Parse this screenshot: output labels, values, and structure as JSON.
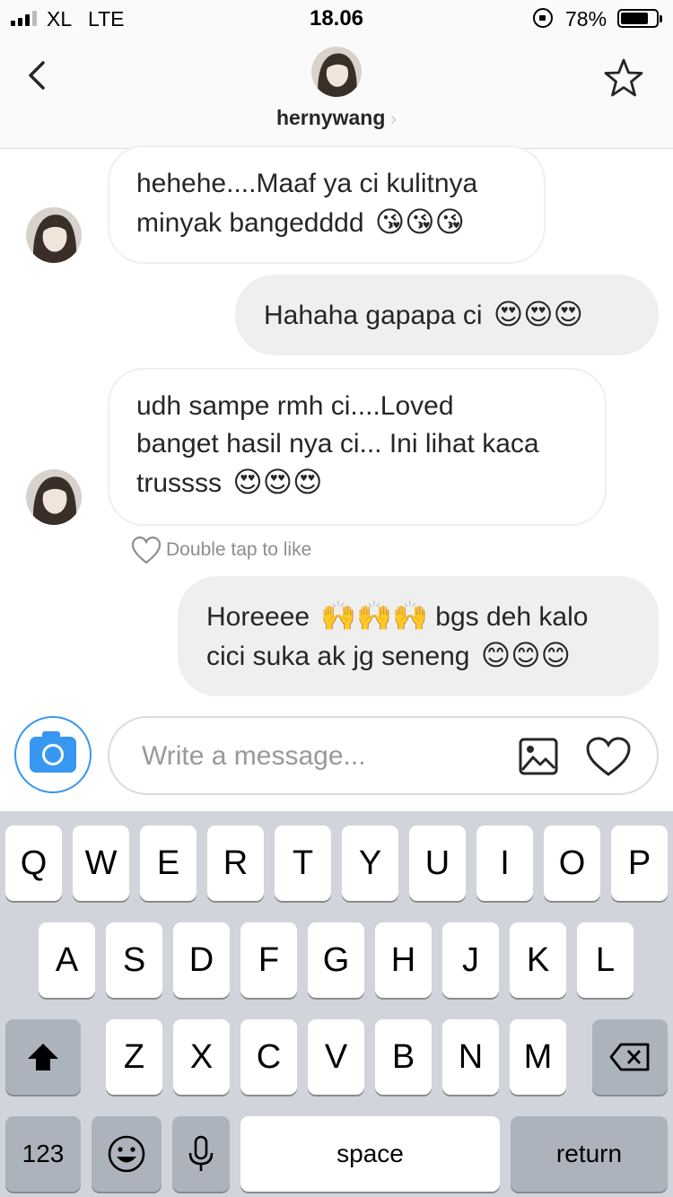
{
  "status_bar": {
    "carrier": "XL",
    "network": "LTE",
    "time": "18.06",
    "battery": "78%",
    "battery_level": 0.78
  },
  "header": {
    "username": "hernywang",
    "chevron": "›",
    "back_icon": "chevron-left-icon",
    "star_icon": "star-icon"
  },
  "messages": [
    {
      "sender": "them",
      "lines": [
        "hehehe....Maaf ya ci kulitnya",
        "minyak bangedddd"
      ],
      "emoji": "😘😘😘"
    },
    {
      "sender": "me",
      "lines": [
        "Hahaha gapapa ci"
      ],
      "emoji": "😍😍😍"
    },
    {
      "sender": "them",
      "lines": [
        "udh sampe rmh ci....Loved",
        "banget hasil nya ci... Ini lihat kaca",
        "trussss"
      ],
      "emoji": "😍😍😍"
    },
    {
      "sender": "me",
      "line1_before": "Horeeee",
      "line1_emoji": "🙌🙌🙌",
      "line1_after": "bgs deh kalo",
      "line2": "cici suka ak jg seneng",
      "emoji": "😊😊😊"
    }
  ],
  "double_tap_hint": "Double tap to like",
  "composer": {
    "placeholder": "Write a message...",
    "camera_icon": "camera-icon",
    "gallery_icon": "gallery-icon",
    "like_icon": "heart-icon"
  },
  "keyboard": {
    "row1": [
      "Q",
      "W",
      "E",
      "R",
      "T",
      "Y",
      "U",
      "I",
      "O",
      "P"
    ],
    "row2": [
      "A",
      "S",
      "D",
      "F",
      "G",
      "H",
      "J",
      "K",
      "L"
    ],
    "row3": [
      "Z",
      "X",
      "C",
      "V",
      "B",
      "N",
      "M"
    ],
    "numbers": "123",
    "space": "space",
    "return": "return"
  },
  "colors": {
    "accent": "#3897f0",
    "bubble_out": "#efefef",
    "keyboard_bg": "#d1d5db"
  }
}
